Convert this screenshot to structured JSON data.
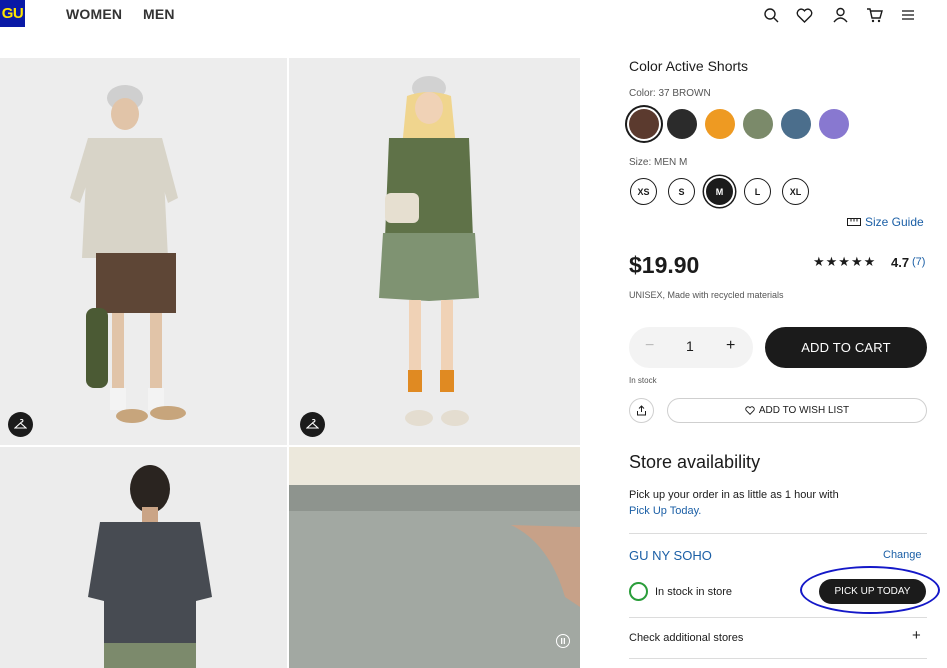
{
  "header": {
    "logo": "GU",
    "nav": [
      "WOMEN",
      "MEN"
    ],
    "icons": [
      "search-icon",
      "heart-icon",
      "user-icon",
      "cart-icon",
      "menu-icon"
    ]
  },
  "product": {
    "title": "Color Active Shorts",
    "color_label": "Color: 37 BROWN",
    "colors": [
      "#5b3a2e",
      "#2b2b2b",
      "#ee9a22",
      "#7b8a6a",
      "#4b6e8c",
      "#8878d0"
    ],
    "size_label": "Size: MEN M",
    "sizes": [
      "XS",
      "S",
      "M",
      "L",
      "XL"
    ],
    "selected_size": "M",
    "size_guide": "Size Guide",
    "price": "$19.90",
    "stars": "★★★★★",
    "rating": "4.7",
    "review_count": "(7)",
    "attributes": "UNISEX,  Made with recycled materials",
    "quantity": "1",
    "quantity_minus": "−",
    "quantity_plus": "+",
    "add_to_cart": "ADD TO CART",
    "stock_status": "In stock",
    "wishlist": "ADD TO WISH LIST"
  },
  "store": {
    "heading": "Store availability",
    "description": "Pick up your order in as little as 1 hour with",
    "description_link": "Pick Up Today.",
    "name": "GU NY SOHO",
    "change": "Change",
    "in_store": "In stock in store",
    "pick_up": "PICK UP TODAY",
    "check_more": "Check additional stores",
    "check_more_icon": "+"
  }
}
